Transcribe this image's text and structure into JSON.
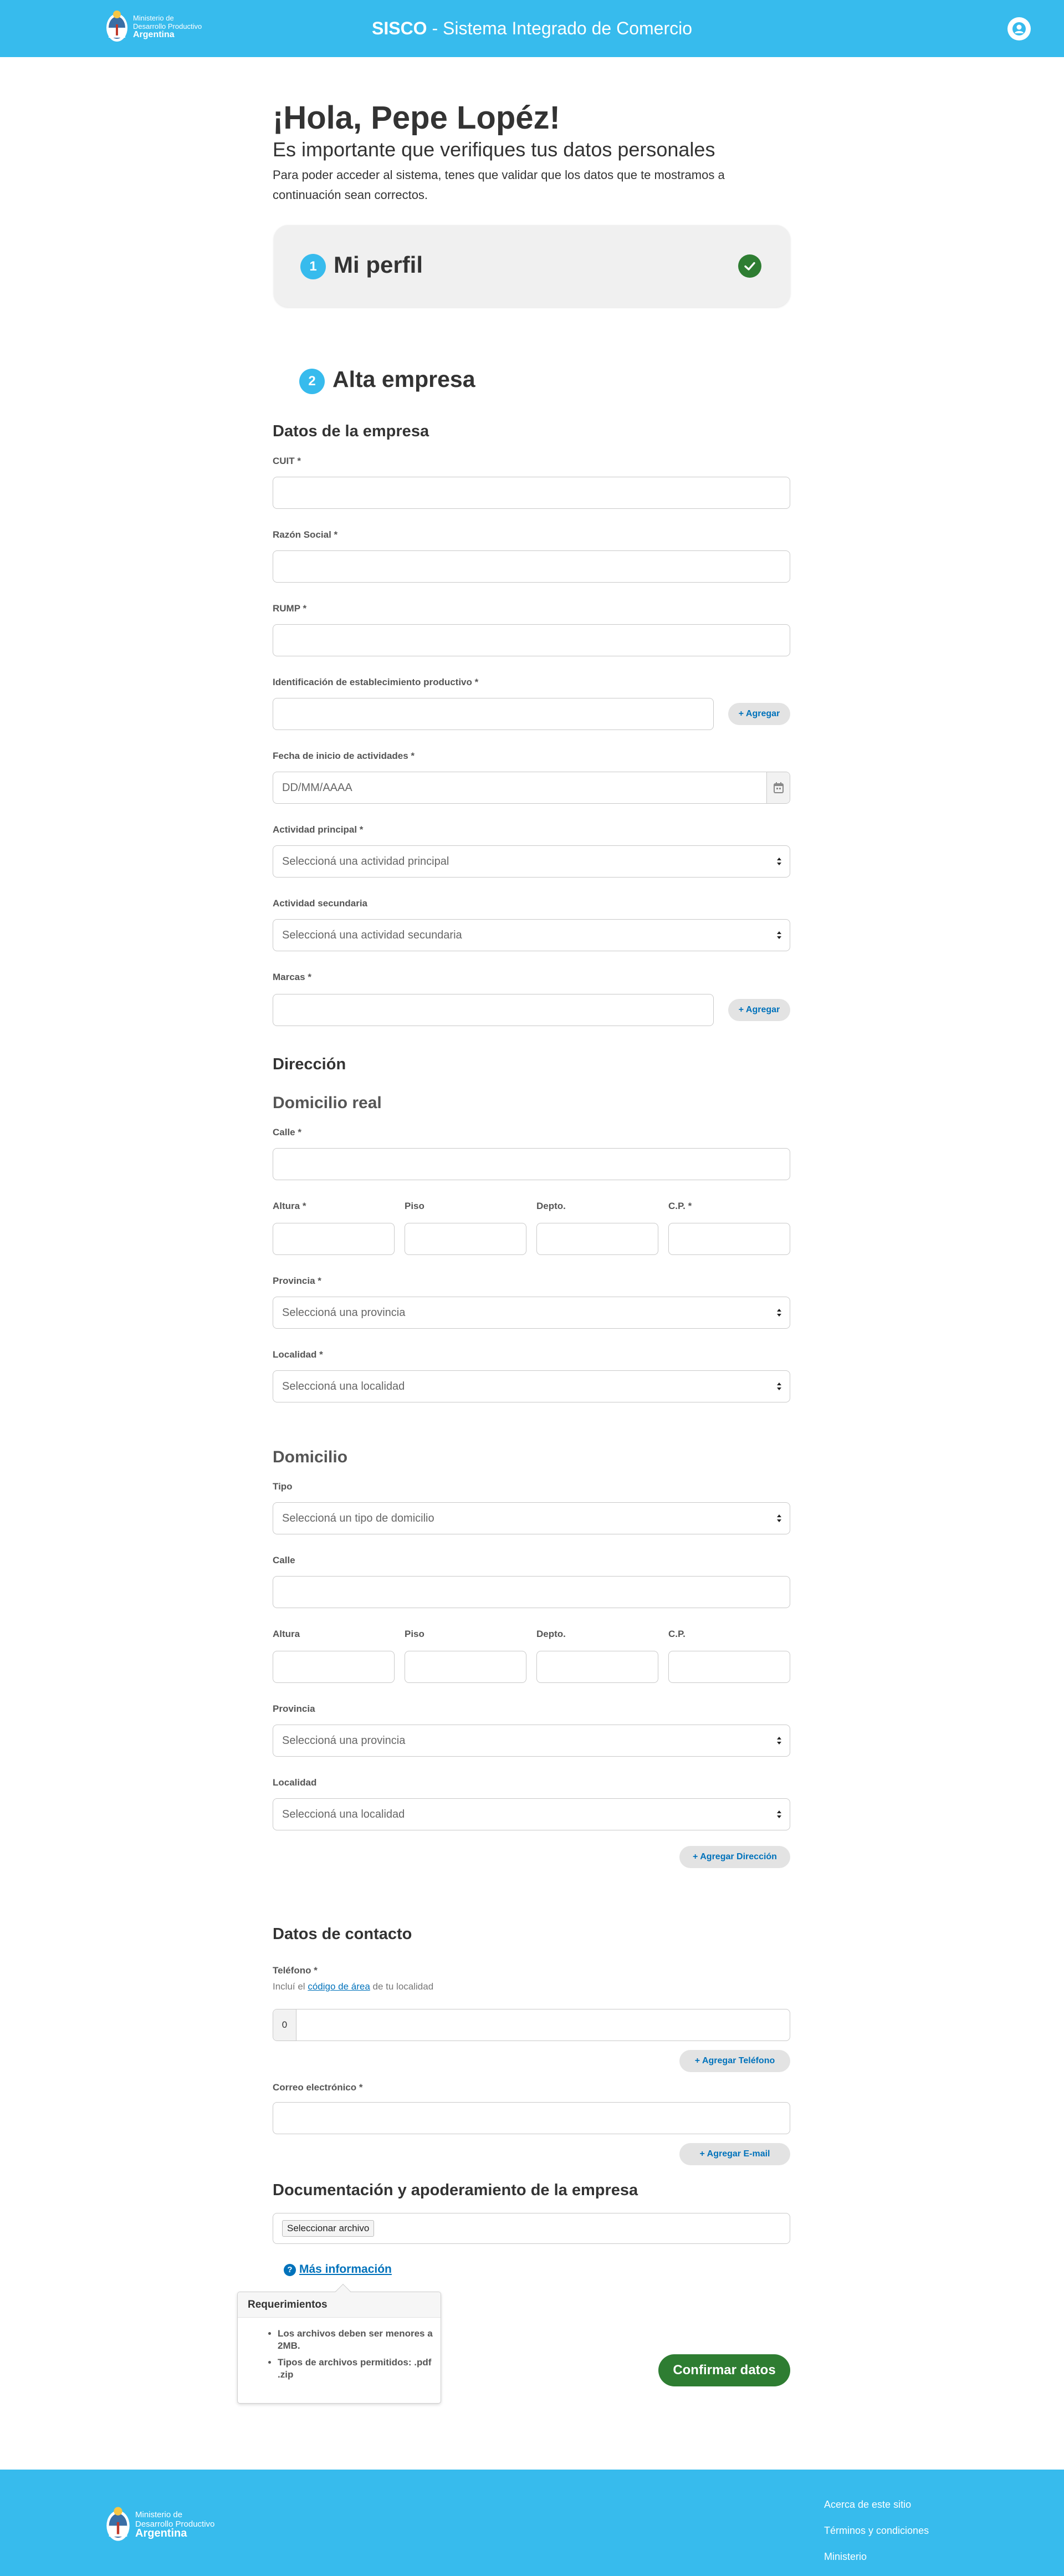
{
  "header": {
    "brand_line1": "Ministerio de",
    "brand_line2": "Desarrollo Productivo",
    "brand_line3": "Argentina",
    "title_bold": "SISCO",
    "title_rest": " - Sistema Integrado de Comercio",
    "user_icon": "user-icon"
  },
  "greeting": {
    "title": "¡Hola, Pepe Lopéz!",
    "subtitle": "Es importante que verifiques tus datos personales",
    "description": "Para poder acceder al sistema, tenes que validar que los datos que te mostramos a continuación sean correctos."
  },
  "steps": {
    "step1": {
      "number": "1",
      "title": "Mi perfil",
      "status": "completed"
    },
    "step2": {
      "number": "2",
      "title": "Alta empresa"
    }
  },
  "empresa": {
    "heading": "Datos de la empresa",
    "cuit_label": "CUIT *",
    "razon_label": "Razón Social *",
    "rump_label": "RUMP *",
    "establecimiento_label": "Identificación de establecimiento productivo *",
    "agregar": "+ Agregar",
    "fecha_label": "Fecha de inicio de actividades *",
    "fecha_placeholder": "DD/MM/AAAA",
    "actividad_principal_label": "Actividad principal *",
    "actividad_principal_value": "Seleccioná una actividad principal",
    "actividad_secundaria_label": "Actividad secundaria",
    "actividad_secundaria_value": "Seleccioná una actividad secundaria",
    "marcas_label": "Marcas *"
  },
  "direccion": {
    "heading": "Dirección",
    "real": {
      "heading": "Domicilio real",
      "calle_label": "Calle *",
      "altura_label": "Altura *",
      "piso_label": "Piso",
      "depto_label": "Depto.",
      "cp_label": "C.P. *",
      "provincia_label": "Provincia *",
      "provincia_value": "Seleccioná una provincia",
      "localidad_label": "Localidad *",
      "localidad_value": "Seleccioná una localidad"
    },
    "domicilio": {
      "heading": "Domicilio",
      "tipo_label": "Tipo",
      "tipo_value": "Seleccioná un tipo de domicilio",
      "calle_label": "Calle",
      "altura_label": "Altura",
      "piso_label": "Piso",
      "depto_label": "Depto.",
      "cp_label": "C.P.",
      "provincia_label": "Provincia",
      "provincia_value": "Seleccioná una provincia",
      "localidad_label": "Localidad",
      "localidad_value": "Seleccioná una localidad",
      "add_button": "+ Agregar Dirección"
    }
  },
  "contacto": {
    "heading": "Datos de contacto",
    "telefono_label": "Teléfono *",
    "hint_pre": "Incluí el ",
    "hint_link": "código de área",
    "hint_post": " de tu localidad",
    "telefono_prefix": "0",
    "add_phone": "+ Agregar Teléfono",
    "email_label": "Correo electrónico *",
    "add_email": "+ Agregar E-mail"
  },
  "documentacion": {
    "heading": "Documentación y apoderamiento de la empresa",
    "file_button": "Seleccionar archivo",
    "more_info": "Más información",
    "popover_title": "Requerimientos",
    "req1": "Los archivos deben ser menores a 2MB.",
    "req2": "Tipos de archivos permitidos: .pdf .zip",
    "confirm": "Confirmar datos"
  },
  "footer": {
    "brand_line1": "Ministerio de",
    "brand_line2": "Desarrollo Productivo",
    "brand_line3": "Argentina",
    "links": [
      "Acerca de este sitio",
      "Términos y condiciones",
      "Ministerio"
    ]
  },
  "colors": {
    "header": "#37bbed",
    "success": "#2e7d32",
    "link": "#0072bb"
  }
}
